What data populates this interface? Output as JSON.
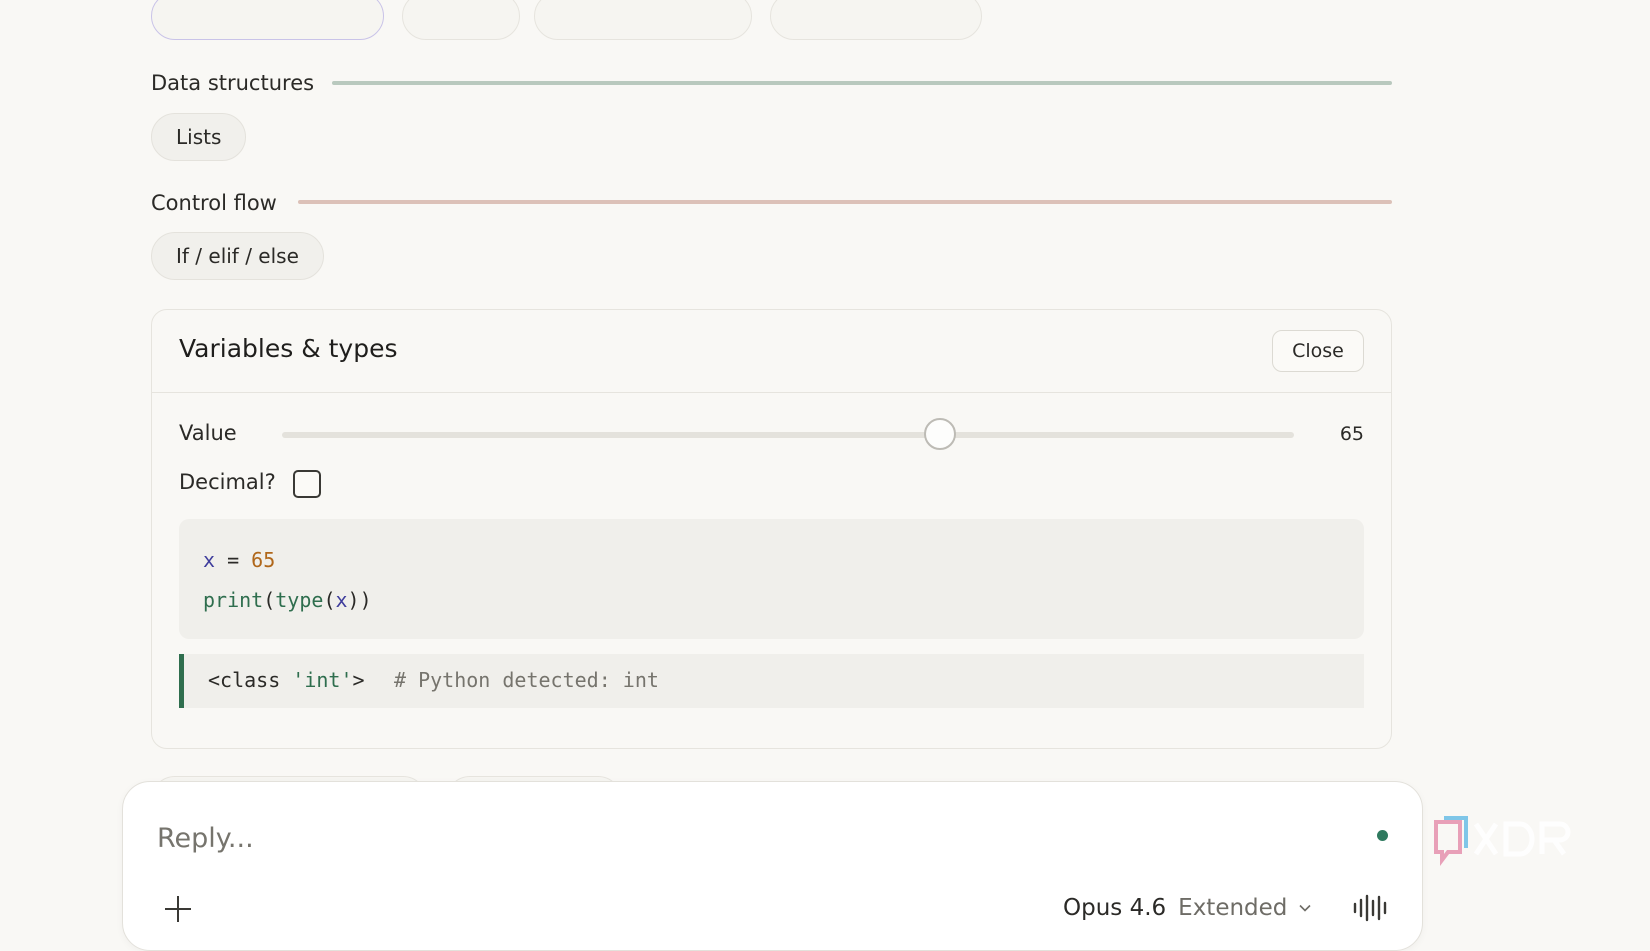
{
  "sections": [
    {
      "label": "Data structures",
      "line_color": "#b9c9be",
      "chips": [
        "Lists"
      ]
    },
    {
      "label": "Control flow",
      "line_color": "#dcc1b8",
      "chips": [
        "If / elif / else"
      ]
    }
  ],
  "panel": {
    "title": "Variables & types",
    "close_label": "Close",
    "value_label": "Value",
    "value": "65",
    "slider": {
      "min": 0,
      "max": 100,
      "value": 65
    },
    "decimal_label": "Decimal?",
    "decimal_checked": false,
    "code": {
      "line1": {
        "var": "x",
        "op": " = ",
        "num": "65"
      },
      "line2": {
        "fn": "print",
        "p1": "(",
        "fn2": "type",
        "p2": "(",
        "arg": "x",
        "p3": "))"
      }
    },
    "output": {
      "prefix": "<class ",
      "type_str": "'int'",
      "suffix": ">",
      "comment": "# Python detected: int"
    }
  },
  "composer": {
    "placeholder": "Reply...",
    "model": "Opus 4.6",
    "mode": "Extended"
  },
  "icons": [
    "plus-icon",
    "chevron-down-icon",
    "voice-icon",
    "status-dot"
  ],
  "colors": {
    "accent_green": "#2f6e4e",
    "number_orange": "#b0671a",
    "var_purple": "#3f3d9c"
  }
}
